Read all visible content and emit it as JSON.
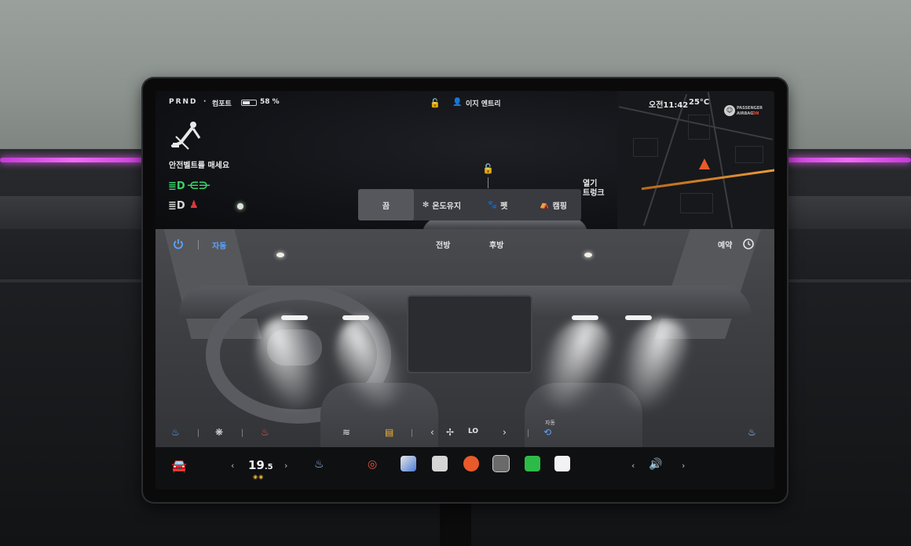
{
  "status_bar": {
    "gear": "PRND",
    "dot": "·",
    "drive_mode": "컴포트",
    "battery_percent": "58 %",
    "battery_level": 0.58,
    "profile": "이지 엔트리",
    "time": "오전11:42",
    "outside_temp": "25°C",
    "airbag_line1": "PASSENGER",
    "airbag_line2": "AIRBAG",
    "airbag_state": "ON"
  },
  "alerts": {
    "seatbelt_text": "안전벨트를 매세요"
  },
  "car_view": {
    "trunk_line1": "열기",
    "trunk_line2": "트렁크"
  },
  "climate_modes": [
    {
      "label": "끔",
      "icon": "",
      "active": true
    },
    {
      "label": "온도유지",
      "icon": "fan-icon",
      "active": false
    },
    {
      "label": "펫",
      "icon": "paw-icon",
      "active": false
    },
    {
      "label": "캠핑",
      "icon": "tent-icon",
      "active": false
    }
  ],
  "climate": {
    "auto_label": "자동",
    "front_label": "전방",
    "rear_label": "후방",
    "schedule_label": "예약",
    "fan_level": "LO",
    "recirc_auto_label": "자동"
  },
  "dock": {
    "temperature": "19",
    "temperature_decimal": ".5"
  },
  "colors": {
    "accent_blue": "#5aa3ff",
    "lamp_green": "#38d16a",
    "belt_red": "#e03838",
    "heat_orange": "#f0b533",
    "ambient_pink": "#e45ef0"
  }
}
